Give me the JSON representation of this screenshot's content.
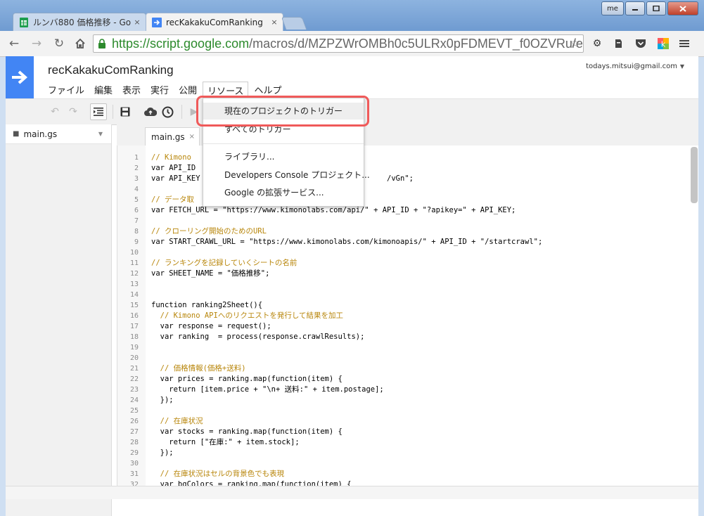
{
  "browser": {
    "tabs": [
      {
        "title": "ルンバ880 価格推移 - Go",
        "close": "×"
      },
      {
        "title": "recKakakuComRanking",
        "close": "×"
      }
    ],
    "user_label": "me",
    "url_host": "https://script.google.com",
    "url_path": "/macros/d/MZPZWrOMBh0c5ULRx0pFDMEVT_f0OZVRu/e",
    "accent": "#2c8a2c"
  },
  "app": {
    "title": "recKakakuComRanking",
    "account": "todays.mitsui@gmail.com",
    "menus": [
      "ファイル",
      "編集",
      "表示",
      "実行",
      "公開",
      "リソース",
      "ヘルプ"
    ],
    "brand_color": "#4285f4"
  },
  "sidebar": {
    "file": "main.gs"
  },
  "editor": {
    "tab": "main.gs",
    "tab_close": "×",
    "lines": [
      {
        "n": "1",
        "t": "// Kimono"
      },
      {
        "n": "2",
        "t": "var API_ID"
      },
      {
        "n": "3",
        "t": "var API_KEY                                          /vGn\";"
      },
      {
        "n": "4",
        "t": ""
      },
      {
        "n": "5",
        "t": "// データ取"
      },
      {
        "n": "6",
        "t": "var FETCH_URL = \"https://www.kimonolabs.com/api/\" + API_ID + \"?apikey=\" + API_KEY;"
      },
      {
        "n": "7",
        "t": ""
      },
      {
        "n": "8",
        "t": "// クローリング開始のためのURL"
      },
      {
        "n": "9",
        "t": "var START_CRAWL_URL = \"https://www.kimonolabs.com/kimonoapis/\" + API_ID + \"/startcrawl\";"
      },
      {
        "n": "10",
        "t": ""
      },
      {
        "n": "11",
        "t": "// ランキングを記録していくシートの名前"
      },
      {
        "n": "12",
        "t": "var SHEET_NAME = \"価格推移\";"
      },
      {
        "n": "13",
        "t": ""
      },
      {
        "n": "14",
        "t": ""
      },
      {
        "n": "15",
        "t": "function ranking2Sheet(){"
      },
      {
        "n": "16",
        "t": "  // Kimono APIへのリクエストを発行して結果を加工"
      },
      {
        "n": "17",
        "t": "  var response = request();"
      },
      {
        "n": "18",
        "t": "  var ranking  = process(response.crawlResults);"
      },
      {
        "n": "19",
        "t": ""
      },
      {
        "n": "20",
        "t": ""
      },
      {
        "n": "21",
        "t": "  // 価格情報(価格+送料)"
      },
      {
        "n": "22",
        "t": "  var prices = ranking.map(function(item) {"
      },
      {
        "n": "23",
        "t": "    return [item.price + \"\\n+ 送料:\" + item.postage];"
      },
      {
        "n": "24",
        "t": "  });"
      },
      {
        "n": "25",
        "t": ""
      },
      {
        "n": "26",
        "t": "  // 在庫状況"
      },
      {
        "n": "27",
        "t": "  var stocks = ranking.map(function(item) {"
      },
      {
        "n": "28",
        "t": "    return [\"在庫:\" + item.stock];"
      },
      {
        "n": "29",
        "t": "  });"
      },
      {
        "n": "30",
        "t": ""
      },
      {
        "n": "31",
        "t": "  // 在庫状況はセルの背景色でも表現"
      },
      {
        "n": "32",
        "t": "  var bgColors = ranking.map(function(item) {"
      }
    ]
  },
  "dropdown": {
    "items": [
      "現在のプロジェクトのトリガー",
      "すべてのトリガー",
      "ライブラリ...",
      "Developers Console プロジェクト...",
      "Google の拡張サービス..."
    ],
    "highlight_color": "#f05a5a"
  }
}
